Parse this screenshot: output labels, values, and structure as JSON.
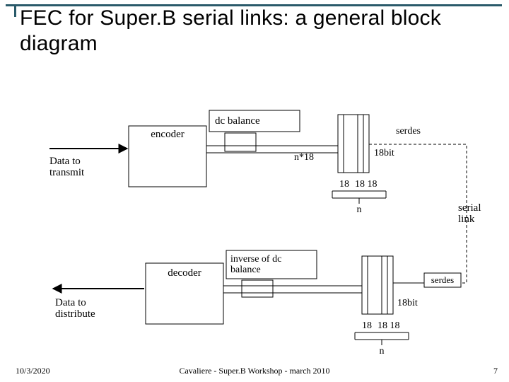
{
  "title": "FEC for Super.B serial links: a general block diagram",
  "footer": {
    "date": "10/3/2020",
    "center": "Cavaliere - Super.B Workshop - march 2010",
    "page": "7"
  },
  "diagram": {
    "data_tx": "Data to\ntransmit",
    "data_dx": "Data to\ndistribute",
    "encoder": "encoder",
    "decoder": "decoder",
    "dc_balance": "dc balance",
    "inv_dc_balance": "inverse of dc\nbalance",
    "serdes": "serdes",
    "serial_link": "serial\nlink",
    "n18": "n*18",
    "bits18": "18bit",
    "lbl18": "18",
    "lbl1818": "18 18",
    "lbl_n": "n"
  }
}
